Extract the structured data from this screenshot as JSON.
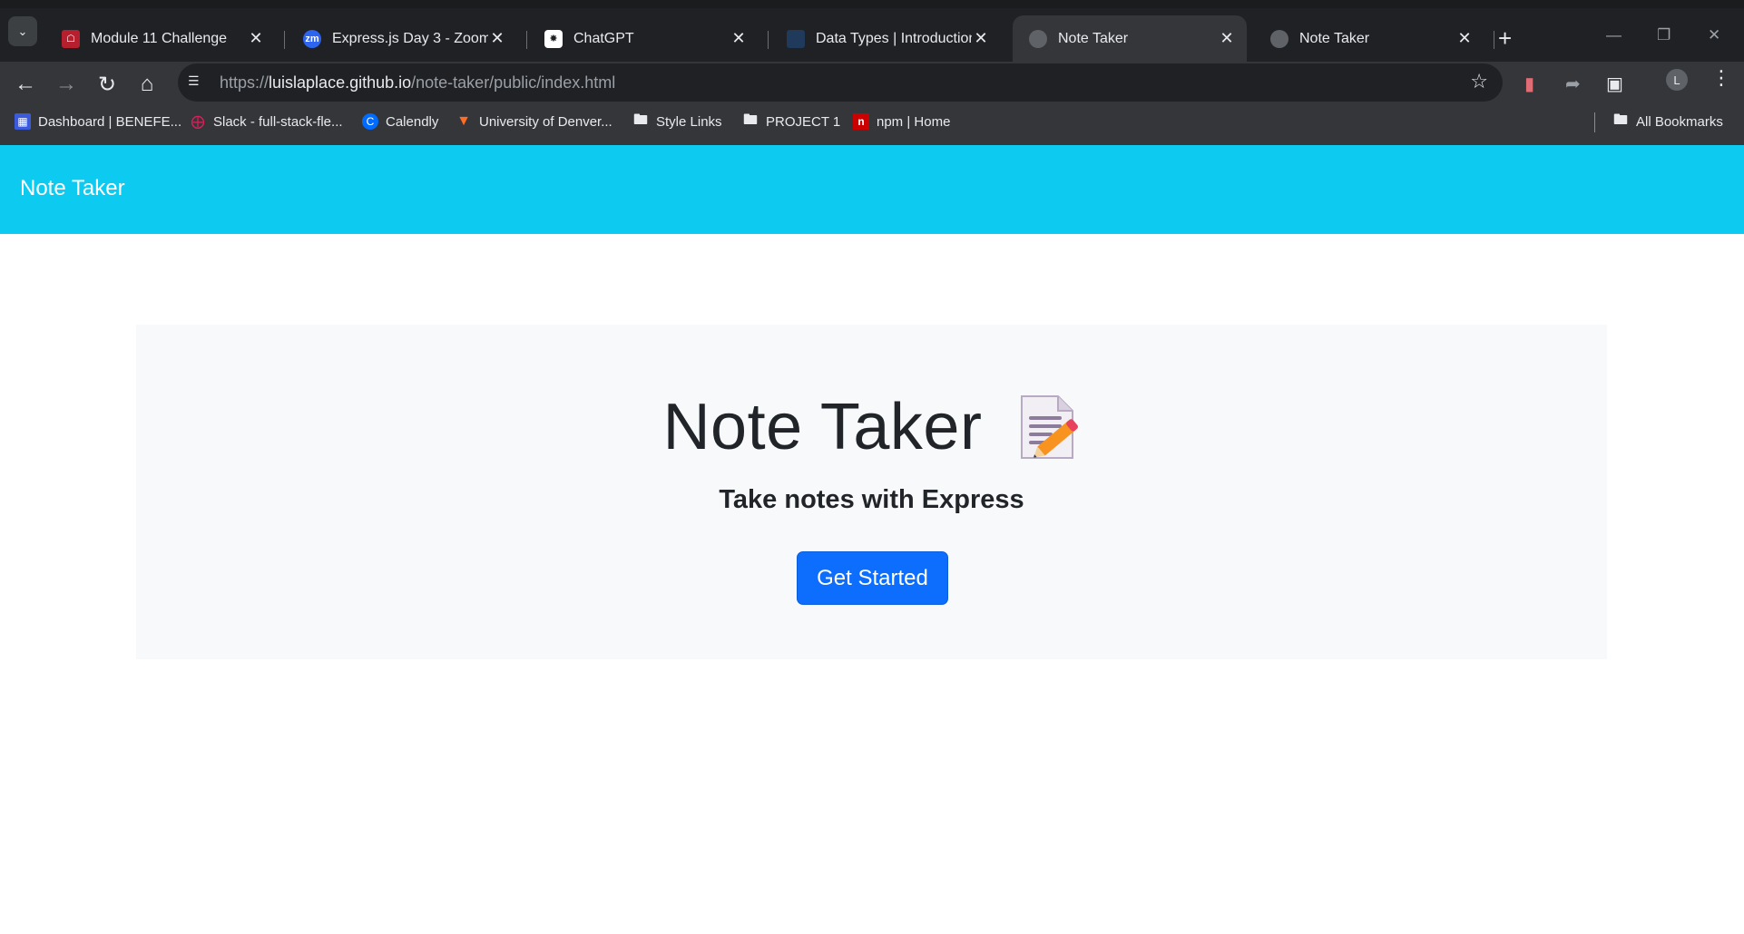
{
  "browser": {
    "tabs": [
      {
        "title": "Module 11 Challenge",
        "favicon": "shield-icon",
        "active": false
      },
      {
        "title": "Express.js Day 3 - Zoom",
        "favicon": "zoom-icon",
        "favicon_text": "zm",
        "active": false
      },
      {
        "title": "ChatGPT",
        "favicon": "chatgpt-icon",
        "active": false
      },
      {
        "title": "Data Types | Introduction t",
        "favicon": "document-icon",
        "active": false
      },
      {
        "title": "Note Taker",
        "favicon": "globe-icon",
        "active": true
      },
      {
        "title": "Note Taker",
        "favicon": "globe-icon",
        "active": false
      }
    ],
    "url": {
      "scheme": "https://",
      "host": "luislaplace.github.io",
      "path": "/note-taker/public/index.html"
    },
    "profile_initial": "L",
    "bookmarks": [
      {
        "label": "Dashboard | BENEFE...",
        "icon": "dashboard-icon"
      },
      {
        "label": "Slack - full-stack-fle...",
        "icon": "slack-icon"
      },
      {
        "label": "Calendly",
        "icon": "calendly-icon"
      },
      {
        "label": "University of Denver...",
        "icon": "gitlab-icon"
      },
      {
        "label": "Style Links",
        "icon": "folder-icon"
      },
      {
        "label": "PROJECT 1",
        "icon": "folder-icon"
      },
      {
        "label": "npm | Home",
        "icon": "npm-icon"
      }
    ],
    "all_bookmarks_label": "All Bookmarks"
  },
  "page": {
    "navbar": {
      "brand": "Note Taker"
    },
    "hero": {
      "title": "Note Taker",
      "subtitle": "Take notes with Express",
      "cta_label": "Get Started",
      "title_icon": "memo-pencil-icon"
    }
  },
  "colors": {
    "navbar_bg": "#0dcaf0",
    "hero_bg": "#f8f9fa",
    "button_primary": "#0d6efd"
  }
}
